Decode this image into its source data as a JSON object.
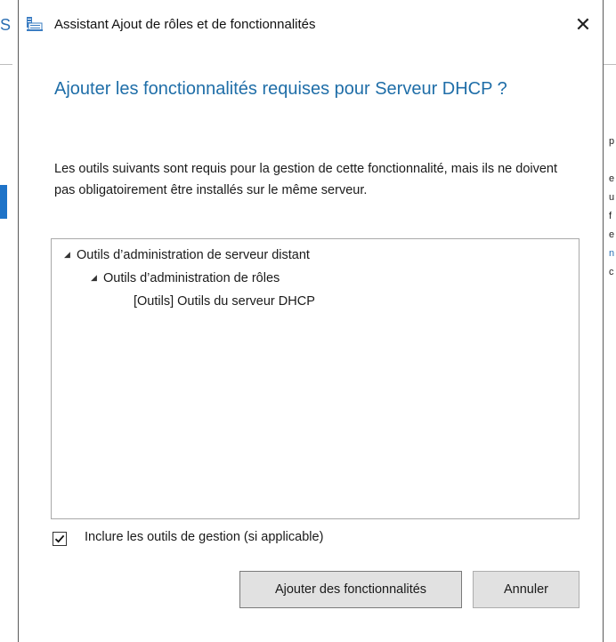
{
  "background": {
    "left_letter": "S",
    "right_letters": [
      "p",
      "",
      "e",
      "u",
      "f",
      "e",
      "n",
      "c"
    ]
  },
  "dialog": {
    "title": "Assistant Ajout de rôles et de fonctionnalités",
    "close_glyph": "✕",
    "heading": "Ajouter les fonctionnalités requises pour Serveur DHCP ?",
    "description": "Les outils suivants sont requis pour la gestion de cette fonctionnalité, mais ils ne doivent pas obligatoirement être installés sur le même serveur.",
    "tree": [
      {
        "label": "Outils d’administration de serveur distant",
        "level": 0,
        "expanded": true
      },
      {
        "label": "Outils d’administration de rôles",
        "level": 1,
        "expanded": true
      },
      {
        "label": "[Outils] Outils du serveur DHCP",
        "level": 2,
        "expanded": false
      }
    ],
    "checkbox": {
      "label": "Inclure les outils de gestion (si applicable)",
      "checked": true
    },
    "buttons": {
      "add": "Ajouter des fonctionnalités",
      "cancel": "Annuler"
    }
  },
  "colors": {
    "heading": "#1f6ea8",
    "accent": "#1e73c8"
  },
  "icons": {
    "title": "server-wizard-icon",
    "close": "close-icon",
    "tree": "expand-triangle-icon",
    "check": "checkmark-icon"
  }
}
